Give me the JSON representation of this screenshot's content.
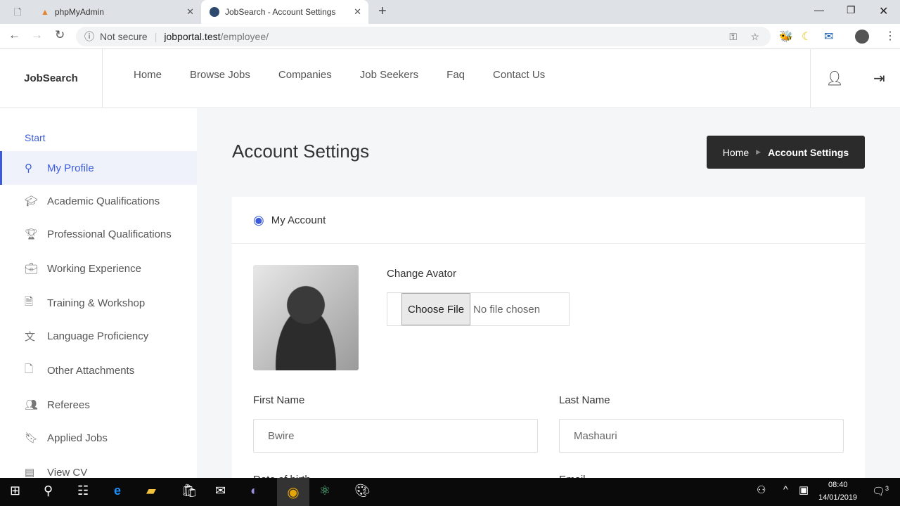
{
  "browser": {
    "tabs": [
      {
        "label": "phpMyAdmin"
      },
      {
        "label": "JobSearch - Account Settings"
      }
    ],
    "security": "Not secure",
    "url_host": "jobportal.test",
    "url_path": "/employee/"
  },
  "header": {
    "brand": "JobSearch",
    "menu": [
      "Home",
      "Browse Jobs",
      "Companies",
      "Job Seekers",
      "Faq",
      "Contact Us"
    ]
  },
  "sidebar": {
    "title": "Start",
    "items": [
      {
        "label": "My Profile",
        "icon": "user-icon"
      },
      {
        "label": "Academic Qualifications",
        "icon": "graduation-cap-icon"
      },
      {
        "label": "Professional Qualifications",
        "icon": "trophy-icon"
      },
      {
        "label": "Working Experience",
        "icon": "briefcase-icon"
      },
      {
        "label": "Training & Workshop",
        "icon": "document-icon"
      },
      {
        "label": "Language Proficiency",
        "icon": "language-icon"
      },
      {
        "label": "Other Attachments",
        "icon": "file-icon"
      },
      {
        "label": "Referees",
        "icon": "users-icon"
      },
      {
        "label": "Applied Jobs",
        "icon": "bookmark-icon"
      },
      {
        "label": "View CV",
        "icon": "cv-icon"
      }
    ]
  },
  "page": {
    "title": "Account Settings",
    "breadcrumb": [
      "Home",
      "Account Settings"
    ]
  },
  "card": {
    "title": "My Account",
    "change_avatar": "Change Avator",
    "choose_file": "Choose File",
    "no_file": "No file chosen",
    "first_name_label": "First Name",
    "first_name": "Bwire",
    "last_name_label": "Last Name",
    "last_name": "Mashauri",
    "dob_label": "Date of birth",
    "email_label": "Email"
  },
  "taskbar": {
    "time": "08:40",
    "date": "14/01/2019",
    "notifications": "3"
  }
}
